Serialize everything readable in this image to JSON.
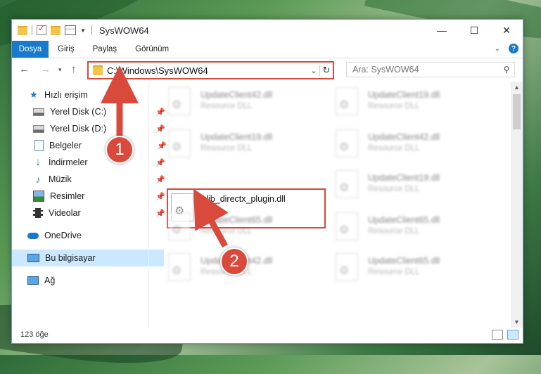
{
  "window": {
    "title": "SysWOW64",
    "controls": {
      "minimize": "—",
      "maximize": "☐",
      "close": "✕"
    }
  },
  "ribbon": {
    "file_tab": "Dosya",
    "tabs": [
      "Giriş",
      "Paylaş",
      "Görünüm"
    ]
  },
  "address_bar": {
    "path": "C:\\Windows\\SysWOW64"
  },
  "search": {
    "placeholder": "Ara: SysWOW64"
  },
  "sidebar": {
    "items": [
      {
        "label": "Hızlı erişim",
        "icon": "star-icon"
      },
      {
        "label": "Yerel Disk (C:)",
        "icon": "disk-icon",
        "pinned": true
      },
      {
        "label": "Yerel Disk (D:)",
        "icon": "disk-icon",
        "pinned": true
      },
      {
        "label": "Belgeler",
        "icon": "document-icon",
        "pinned": true
      },
      {
        "label": "İndirmeler",
        "icon": "download-icon",
        "pinned": true
      },
      {
        "label": "Müzik",
        "icon": "music-icon",
        "pinned": true
      },
      {
        "label": "Resimler",
        "icon": "pictures-icon",
        "pinned": true
      },
      {
        "label": "Videolar",
        "icon": "videos-icon",
        "pinned": true
      },
      {
        "label": "OneDrive",
        "icon": "cloud-icon"
      },
      {
        "label": "Bu bilgisayar",
        "icon": "computer-icon",
        "selected": true
      },
      {
        "label": "Ağ",
        "icon": "network-icon"
      }
    ]
  },
  "files": [
    {
      "name": "UpdateClient42.dll",
      "type": "Resource DLL"
    },
    {
      "name": "UpdateClient19.dll",
      "type": "Resource DLL"
    },
    {
      "name": "UpdateClient19.dll",
      "type": "Resource DLL"
    },
    {
      "name": "UpdateClient42.dll",
      "type": "Resource DLL"
    },
    {
      "name": "klib_directx_plugin.dll",
      "type": ""
    },
    {
      "name": "UpdateClient19.dll",
      "type": "Resource DLL"
    },
    {
      "name": "UpdateClient65.dll",
      "type": "Resource DLL"
    },
    {
      "name": "UpdateClient65.dll",
      "type": "Resource DLL"
    },
    {
      "name": "UpdateClient42.dll",
      "type": "Resource DLL"
    },
    {
      "name": "UpdateClient65.dll",
      "type": "Resource DLL"
    }
  ],
  "status": {
    "item_count": "123 öğe"
  },
  "annotations": {
    "step1": "1",
    "step2": "2",
    "color": "#d9493c"
  }
}
